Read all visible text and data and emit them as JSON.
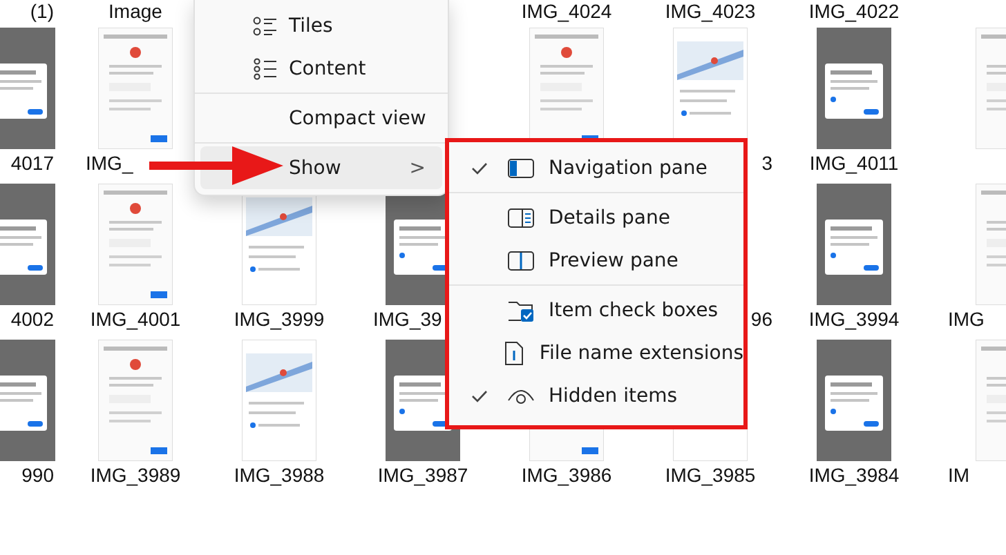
{
  "file_grid": {
    "rows": [
      {
        "items": [
          {
            "label": "(1)",
            "kind": "end"
          },
          {
            "label": "Image",
            "kind": "full"
          },
          {
            "kind": "none"
          },
          {
            "kind": "none"
          },
          {
            "label": "IMG_4024",
            "kind": "full"
          },
          {
            "label": "IMG_4023",
            "kind": "full"
          },
          {
            "label": "IMG_4022",
            "kind": "full"
          },
          {
            "kind": "none"
          }
        ]
      },
      {
        "items": [
          {
            "label": "4017",
            "kind": "end",
            "thumbnail": true
          },
          {
            "label": "IMG_",
            "kind": "start",
            "thumbnail": true
          },
          {
            "kind": "none"
          },
          {
            "kind": "none"
          },
          {
            "kind": "none",
            "thumbnail": true
          },
          {
            "label": "3",
            "kind": "end",
            "thumbnail": true
          },
          {
            "label": "IMG_4011",
            "kind": "full",
            "thumbnail": true
          },
          {
            "kind": "none",
            "thumbnail": true
          }
        ]
      },
      {
        "items": [
          {
            "label": "4002",
            "kind": "end",
            "thumbnail": true
          },
          {
            "label": "IMG_4001",
            "kind": "full",
            "thumbnail": true
          },
          {
            "label": "IMG_3999",
            "kind": "full",
            "thumbnail": true
          },
          {
            "label": "IMG_39",
            "kind": "start",
            "thumbnail": true
          },
          {
            "kind": "none"
          },
          {
            "label": "96",
            "kind": "end"
          },
          {
            "label": "IMG_3994",
            "kind": "full",
            "thumbnail": true
          },
          {
            "label": "IMG",
            "kind": "start",
            "thumbnail": true
          }
        ]
      },
      {
        "items": [
          {
            "label": "990",
            "kind": "end",
            "thumbnail": true
          },
          {
            "label": "IMG_3989",
            "kind": "full",
            "thumbnail": true
          },
          {
            "label": "IMG_3988",
            "kind": "full",
            "thumbnail": true
          },
          {
            "label": "IMG_3987",
            "kind": "full",
            "thumbnail": true
          },
          {
            "label": "IMG_3986",
            "kind": "full",
            "thumbnail": true
          },
          {
            "label": "IMG_3985",
            "kind": "full",
            "thumbnail": true
          },
          {
            "label": "IMG_3984",
            "kind": "full",
            "thumbnail": true
          },
          {
            "label": "IM",
            "kind": "start",
            "thumbnail": true
          }
        ]
      }
    ]
  },
  "view_menu": {
    "items": [
      {
        "kind": "item",
        "label": "Tiles",
        "highlighted": false
      },
      {
        "kind": "item",
        "label": "Content",
        "highlighted": false
      },
      {
        "kind": "divider"
      },
      {
        "kind": "item",
        "label": "Compact view",
        "highlighted": false
      },
      {
        "kind": "divider"
      },
      {
        "kind": "submenu",
        "label": "Show",
        "chevron": ">",
        "highlighted": true
      }
    ]
  },
  "show_submenu": {
    "items": [
      {
        "kind": "item",
        "label": "Navigation pane",
        "checked": true
      },
      {
        "kind": "divider"
      },
      {
        "kind": "item",
        "label": "Details pane",
        "checked": false
      },
      {
        "kind": "item",
        "label": "Preview pane",
        "checked": false
      },
      {
        "kind": "divider"
      },
      {
        "kind": "item",
        "label": "Item check boxes",
        "checked": false
      },
      {
        "kind": "item",
        "label": "File name extensions",
        "checked": false
      },
      {
        "kind": "item",
        "label": "Hidden items",
        "checked": true
      }
    ]
  }
}
